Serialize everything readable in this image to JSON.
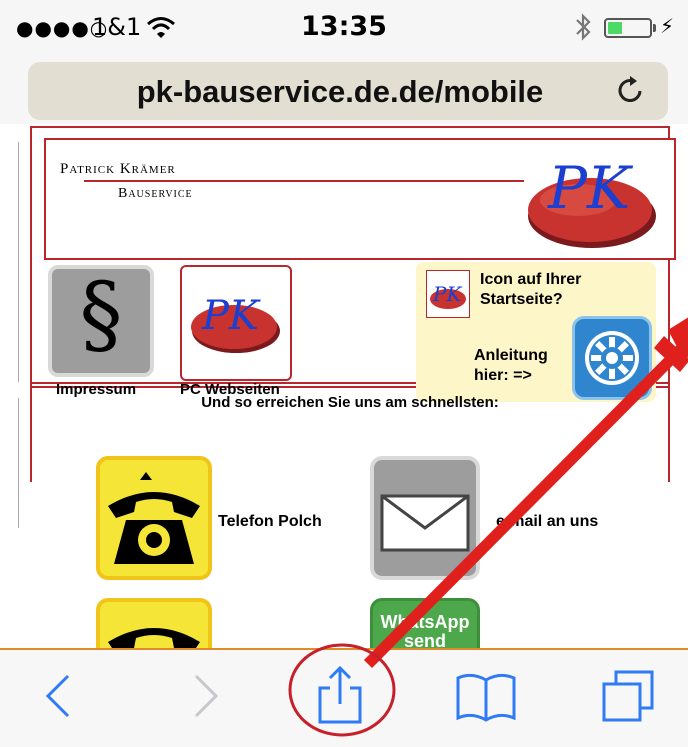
{
  "status_bar": {
    "signal_dots": "●●●●○",
    "carrier": "1&1",
    "wifi_icon": "wifi-icon",
    "time": "13:35",
    "bluetooth_icon": "bluetooth-icon",
    "battery_level": 0.35,
    "battery_color": "#4cd964",
    "charging_icon": "charging-bolt-icon"
  },
  "address_bar": {
    "url": "pk-bauservice.de.de/mobile",
    "reload_icon": "reload-icon"
  },
  "header": {
    "name": "Patrick Krämer",
    "subtitle": "Bauservice",
    "logo_text": "PK"
  },
  "tiles": {
    "impressum_symbol": "§",
    "impressum_label": "Impressum",
    "pc_label": "PC Webseiten",
    "install_title": "Icon auf Ihrer Startseite?",
    "install_howto": "Anleitung hier: =>"
  },
  "contact": {
    "heading": "Und so erreichen Sie uns am schnellsten:",
    "phone_label": "Telefon Polch",
    "mail_label": "e-mail an uns",
    "whatsapp_tile": "WhatsApp send"
  },
  "toolbar": {
    "back_icon": "back-chevron-icon",
    "forward_icon": "forward-chevron-icon",
    "share_icon": "share-icon",
    "bookmarks_icon": "bookmarks-icon",
    "tabs_icon": "tabs-icon"
  },
  "colors": {
    "brand_red": "#b9262b",
    "ios_blue": "#2f7bf6",
    "annotation_red": "#e0201c",
    "phone_yellow": "#f5e536",
    "whatsapp_green": "#4ca84a"
  }
}
